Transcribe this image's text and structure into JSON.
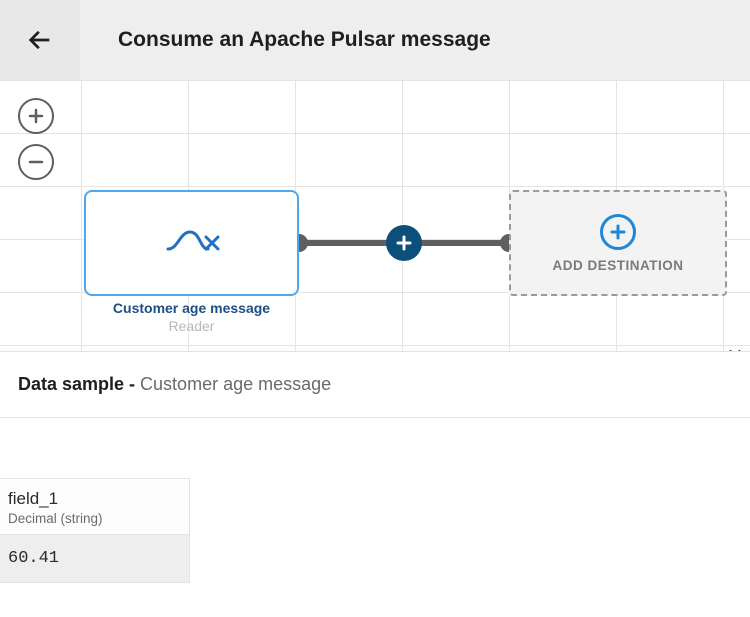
{
  "header": {
    "title": "Consume an Apache Pulsar message"
  },
  "canvas": {
    "sourceNode": {
      "title": "Customer age message",
      "subtitle": "Reader"
    },
    "destination": {
      "label": "ADD DESTINATION"
    }
  },
  "dataSample": {
    "labelPrefix": "Data sample - ",
    "source": "Customer age message",
    "columns": [
      {
        "name": "field_1",
        "type": "Decimal (string)"
      }
    ],
    "rows": [
      {
        "field_1": "60.41"
      }
    ]
  }
}
